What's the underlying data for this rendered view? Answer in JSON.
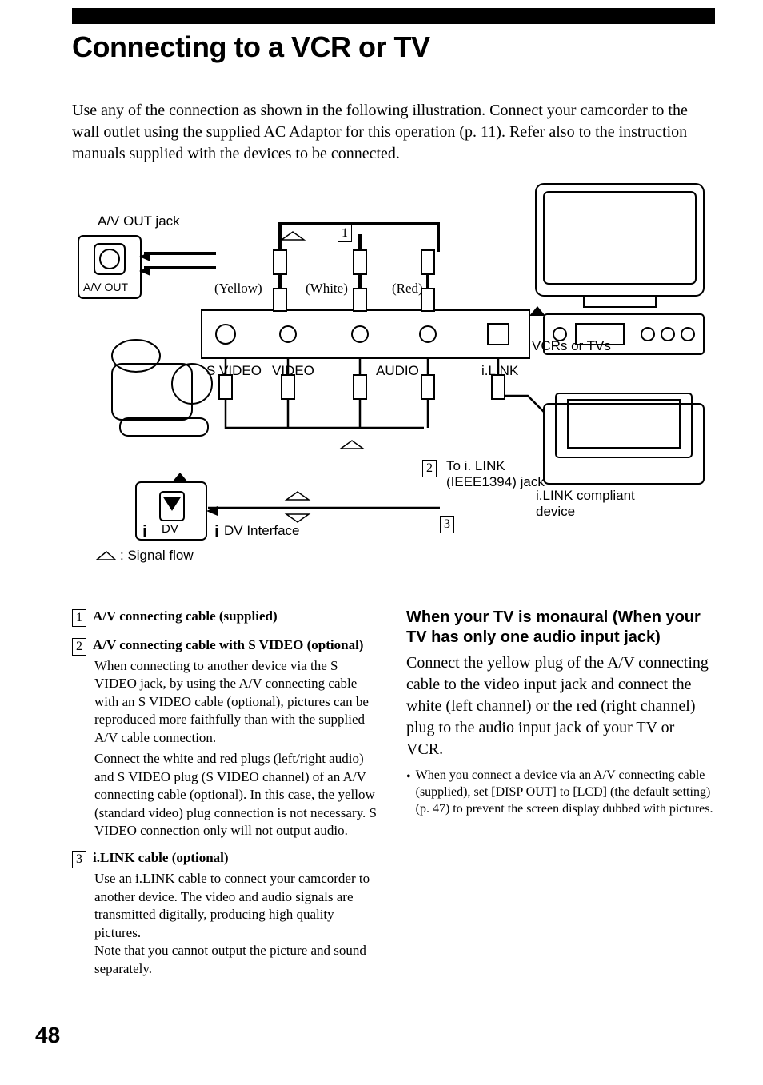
{
  "page_number": "48",
  "title": "Connecting to a VCR or TV",
  "intro": "Use any of the connection as shown in the following illustration. Connect your camcorder to the wall outlet using the supplied AC Adaptor for this operation (p. 11). Refer also to the instruction manuals supplied with the devices to be connected.",
  "diagram": {
    "av_out_jack": "A/V OUT jack",
    "av_out": "A/V OUT",
    "yellow": "(Yellow)",
    "white": "(White)",
    "red": "(Red)",
    "s_video": "S VIDEO",
    "video": "VIDEO",
    "audio": "AUDIO",
    "ilink": "i.LINK",
    "vcrs_tvs": "VCRs or TVs",
    "to_ilink": "To i. LINK",
    "ieee": "(IEEE1394) jack",
    "ilink_compliant": "i.LINK compliant",
    "device": "device",
    "dv": "DV",
    "dv_interface": "DV Interface",
    "signal_flow": ": Signal flow",
    "marker1": "1",
    "marker2": "2",
    "marker3": "3"
  },
  "items": [
    {
      "num": "1",
      "head": "A/V connecting cable (supplied)",
      "body1": "",
      "body2": ""
    },
    {
      "num": "2",
      "head": "A/V connecting cable with S VIDEO (optional)",
      "body1": "When connecting to another device via the S VIDEO jack, by using the A/V connecting cable with an S VIDEO cable (optional), pictures can be reproduced more faithfully than with the supplied A/V cable connection.",
      "body2": "Connect the white and red plugs (left/right audio) and S VIDEO plug (S VIDEO channel) of an A/V connecting cable (optional). In this case, the yellow (standard video) plug connection is not necessary. S VIDEO connection only will not output audio."
    },
    {
      "num": "3",
      "head": "i.LINK cable (optional)",
      "body1": "Use an i.LINK cable to connect your camcorder to another device. The video and audio signals are transmitted digitally, producing high quality pictures.",
      "body2": "Note that you cannot output the picture and sound separately."
    }
  ],
  "right": {
    "subhead": "When your TV is monaural (When your TV has only one audio input jack)",
    "para": "Connect the yellow plug of the A/V connecting cable to the video input jack and connect the white (left channel) or the red (right channel) plug to the audio input jack of your TV or VCR.",
    "bullet": "When you connect a device via an A/V connecting cable (supplied), set [DISP OUT] to [LCD] (the default setting) (p. 47) to prevent the screen display dubbed with pictures."
  }
}
